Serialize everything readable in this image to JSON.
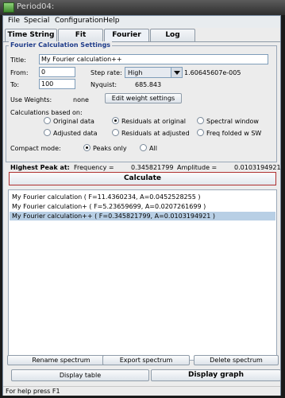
{
  "window": {
    "title": "Period04:"
  },
  "menu": [
    "File",
    "Special",
    "Configuration",
    "Help"
  ],
  "tabs": [
    "Time String",
    "Fit",
    "Fourier",
    "Log"
  ],
  "active_tab": "Fourier",
  "settings": {
    "legend": "Fourier Calculation Settings",
    "title_label": "Title:",
    "title_value": "My Fourier calculation++",
    "from_label": "From:",
    "from_value": "0",
    "to_label": "To:",
    "to_value": "100",
    "step_rate_label": "Step rate:",
    "step_rate_value": "High",
    "step_rate_number": "1.60645607e-005",
    "nyquist_label": "Nyquist:",
    "nyquist_value": "685.843",
    "use_weights_label": "Use Weights:",
    "use_weights_value": "none",
    "edit_weights_button": "Edit weight settings",
    "calc_based_label": "Calculations based on:",
    "options": [
      "Original data",
      "Residuals at original",
      "Spectral window",
      "Adjusted data",
      "Residuals at adjusted",
      "Freq folded w SW"
    ],
    "selected_option": "Residuals at original",
    "compact_label": "Compact mode:",
    "compact_options": [
      "Peaks only",
      "All"
    ],
    "compact_selected": "Peaks only"
  },
  "peak": {
    "label": "Highest Peak at:",
    "freq_label": "Frequency =",
    "freq_value": "0.345821799",
    "amp_label": "Amplitude =",
    "amp_value": "0.0103194921"
  },
  "calculate_button": "Calculate",
  "results": [
    "My Fourier calculation ( F=11.4360234, A=0.0452528255 )",
    "My Fourier calculation+ ( F=5.23659699, A=0.0207261699 )",
    "My Fourier calculation++ ( F=0.345821799, A=0.0103194921 )"
  ],
  "selected_result_index": 2,
  "buttons": {
    "rename": "Rename spectrum",
    "export": "Export spectrum",
    "delete": "Delete spectrum",
    "display_table": "Display table",
    "display_graph": "Display graph"
  },
  "status": "For help press F1",
  "colors": {
    "legend": "#1f3c8a",
    "selection": "#b8cfe5",
    "calculate_border": "#b03030"
  },
  "icons": [
    "app-icon",
    "dropdown-arrow-icon"
  ]
}
